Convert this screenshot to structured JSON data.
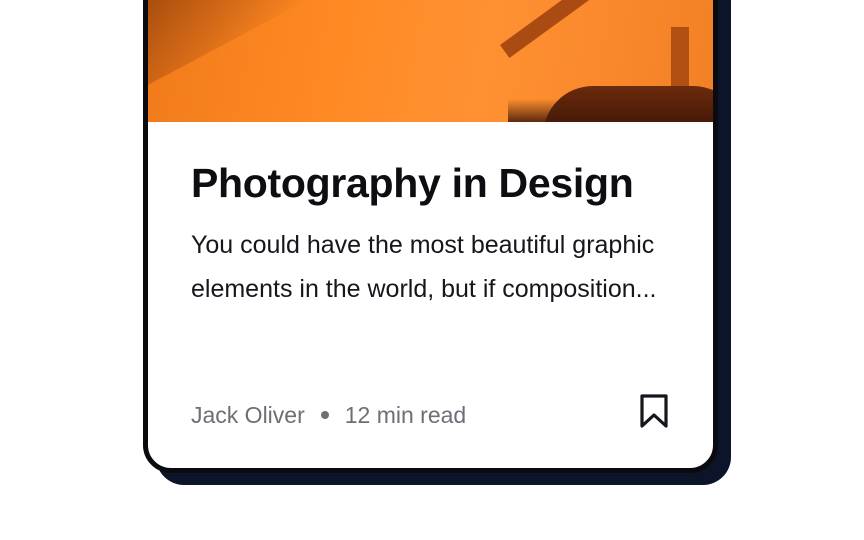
{
  "card": {
    "title": "Photography in Design",
    "excerpt": "You could have the most beautiful graphic elements in the world, but if composition...",
    "author": "Jack Oliver",
    "read_time": "12 min read",
    "bookmark_icon": "bookmark-icon"
  },
  "colors": {
    "hero_orange": "#ff8a24",
    "card_border": "#0b0b0f",
    "card_shadow": "#0b1428",
    "meta_text": "#6e6e76",
    "title_text": "#0d0d12"
  }
}
